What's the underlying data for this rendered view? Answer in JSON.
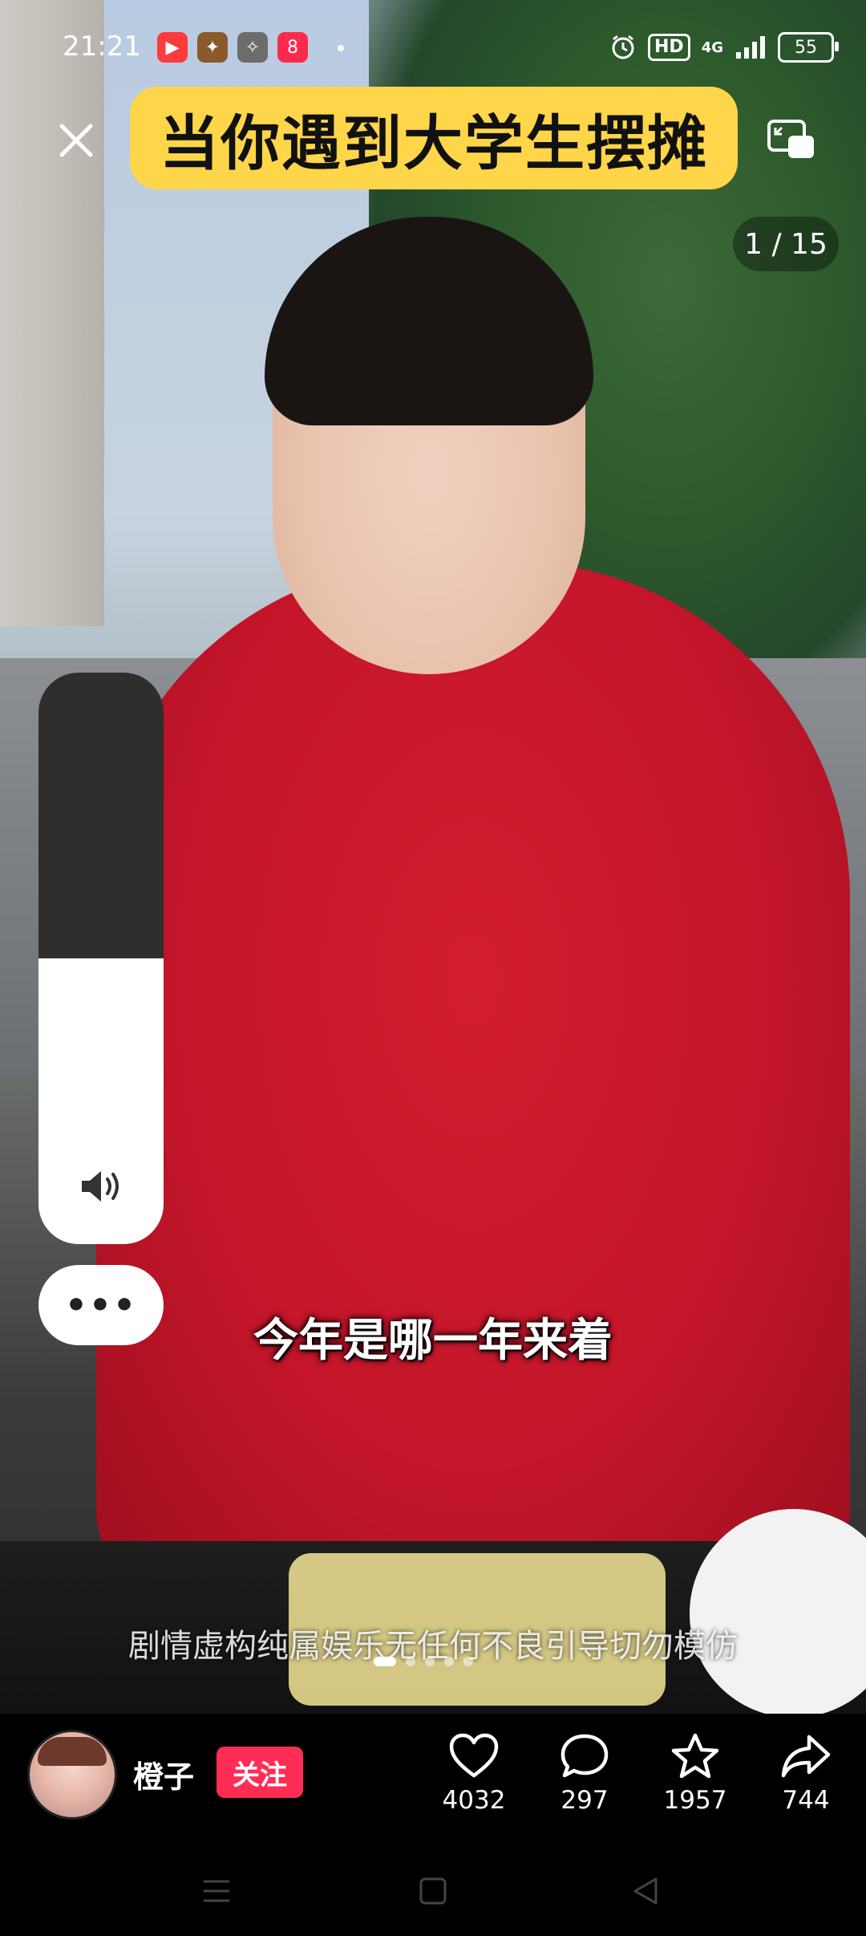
{
  "status_bar": {
    "time": "21:21",
    "notification_icons": [
      "video-app-icon",
      "game-app-icon",
      "game-app-icon-2",
      "shopping-app-icon"
    ],
    "hd_label": "HD",
    "network_label": "4G",
    "battery_level": "55"
  },
  "post": {
    "title": "当你遇到大学生摆摊",
    "page_counter": "1 / 15",
    "subtitle": "今年是哪一年来着",
    "disclaimer": "剧情虚构纯属娱乐无任何不良引导切勿模仿",
    "volume_level": 0.5,
    "more_label": "•••"
  },
  "author": {
    "name": "橙子",
    "follow_label": "关注"
  },
  "actions": {
    "likes": "4032",
    "comments": "297",
    "favorites": "1957",
    "shares": "744"
  },
  "colors": {
    "title_banner": "#ffd54a",
    "follow_button": "#ff2d55"
  }
}
